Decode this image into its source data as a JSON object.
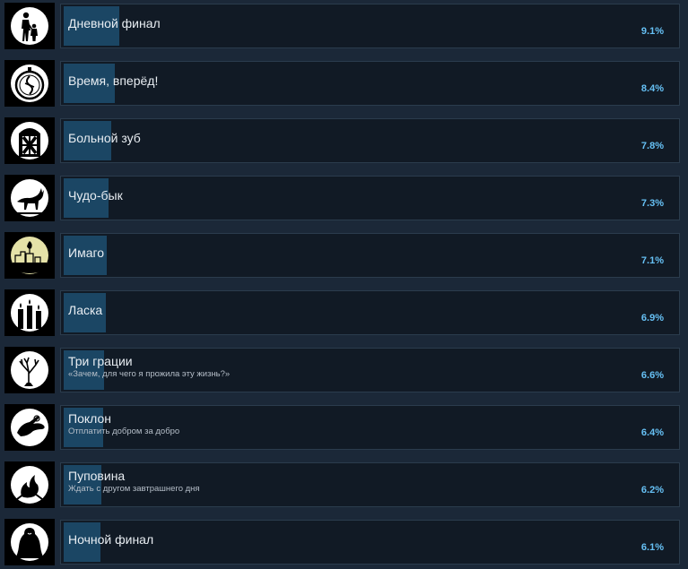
{
  "colors": {
    "background": "#1b2838",
    "card": "#111a25",
    "bar": "#1b4664",
    "percent_text": "#66c0f4",
    "title_text": "#e8edf2",
    "desc_text": "#b5bec8"
  },
  "achievements": [
    {
      "title": "Дневной финал",
      "description": "",
      "percent": "9.1%",
      "percent_value": 9.1,
      "icon": "parent-child-silhouette-icon"
    },
    {
      "title": "Время, вперёд!",
      "description": "",
      "percent": "8.4%",
      "percent_value": 8.4,
      "icon": "pocket-watch-icon"
    },
    {
      "title": "Больной зуб",
      "description": "",
      "percent": "7.8%",
      "percent_value": 7.8,
      "icon": "window-cross-icon"
    },
    {
      "title": "Чудо-бык",
      "description": "",
      "percent": "7.3%",
      "percent_value": 7.3,
      "icon": "bull-icon"
    },
    {
      "title": "Имаго",
      "description": "",
      "percent": "7.1%",
      "percent_value": 7.1,
      "icon": "town-ruins-icon"
    },
    {
      "title": "Ласка",
      "description": "",
      "percent": "6.9%",
      "percent_value": 6.9,
      "icon": "candles-icon"
    },
    {
      "title": "Три грации",
      "description": "«Зачем, для чего я прожила эту жизнь?»",
      "percent": "6.6%",
      "percent_value": 6.6,
      "icon": "bare-tree-icon"
    },
    {
      "title": "Поклон",
      "description": "Отплатить добром за добро",
      "percent": "6.4%",
      "percent_value": 6.4,
      "icon": "hand-icon"
    },
    {
      "title": "Пуповина",
      "description": "Ждать с другом завтрашнего дня",
      "percent": "6.2%",
      "percent_value": 6.2,
      "icon": "fire-figure-icon"
    },
    {
      "title": "Ночной финал",
      "description": "",
      "percent": "6.1%",
      "percent_value": 6.1,
      "icon": "cloaked-figure-icon"
    }
  ]
}
